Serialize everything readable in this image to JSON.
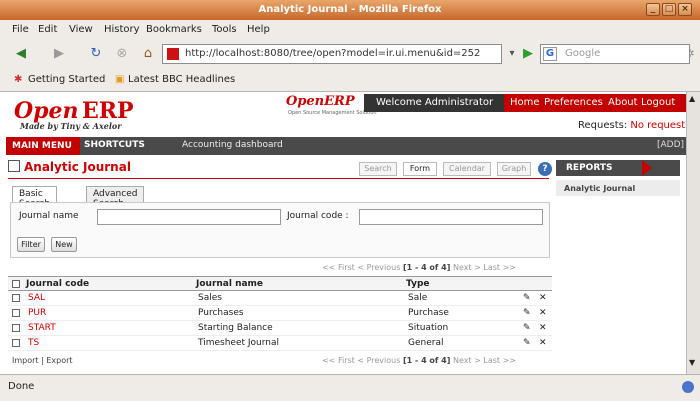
{
  "window": {
    "title": "Analytic Journal - Mozilla Firefox"
  },
  "menubar": [
    "File",
    "Edit",
    "View",
    "History",
    "Bookmarks",
    "Tools",
    "Help"
  ],
  "browser": {
    "url": "http://localhost:8080/tree/open?model=ir.ui.menu&id=252",
    "search_placeholder": "Google"
  },
  "bookmarks": [
    "Getting Started",
    "Latest BBC Headlines"
  ],
  "header": {
    "logo_open": "Open",
    "logo_erp": "ERP",
    "logo_tagline": "Made by Tiny & Axelor",
    "logo2": "OpenERP",
    "logo2_sub": "Open Source Management Solution",
    "welcome": "Welcome Administrator",
    "links": [
      "Home",
      "Preferences",
      "About",
      "Logout"
    ],
    "requests_label": "Requests:",
    "requests_value": "No request"
  },
  "mainnav": {
    "main_menu": "MAIN MENU",
    "shortcuts": "SHORTCUTS",
    "dashboard": "Accounting dashboard",
    "add": "[ADD]"
  },
  "page": {
    "title": "Analytic Journal"
  },
  "views": [
    "Search",
    "Form",
    "Calendar",
    "Graph"
  ],
  "help_icon": "?",
  "sidebar": {
    "header": "REPORTS",
    "items": [
      "Analytic Journal"
    ]
  },
  "search_tabs": [
    "Basic Search",
    "Advanced Search"
  ],
  "search": {
    "journal_name_label": "Journal name",
    "journal_code_label": "Journal code :",
    "filter": "Filter",
    "new": "New"
  },
  "pager": {
    "first": "<< First",
    "prev": "< Previous",
    "range": "[1 - 4 of 4]",
    "next": "Next >",
    "last": "Last >>"
  },
  "grid": {
    "columns": [
      "Journal code",
      "Journal name",
      "Type"
    ],
    "rows": [
      {
        "code": "SAL",
        "name": "Sales",
        "type": "Sale"
      },
      {
        "code": "PUR",
        "name": "Purchases",
        "type": "Purchase"
      },
      {
        "code": "START",
        "name": "Starting Balance",
        "type": "Situation"
      },
      {
        "code": "TS",
        "name": "Timesheet Journal",
        "type": "General"
      }
    ],
    "edit_icon": "✎",
    "delete_icon": "✕"
  },
  "footer": {
    "import": "Import",
    "sep": "|",
    "export": "Export"
  },
  "status": {
    "text": "Done"
  }
}
